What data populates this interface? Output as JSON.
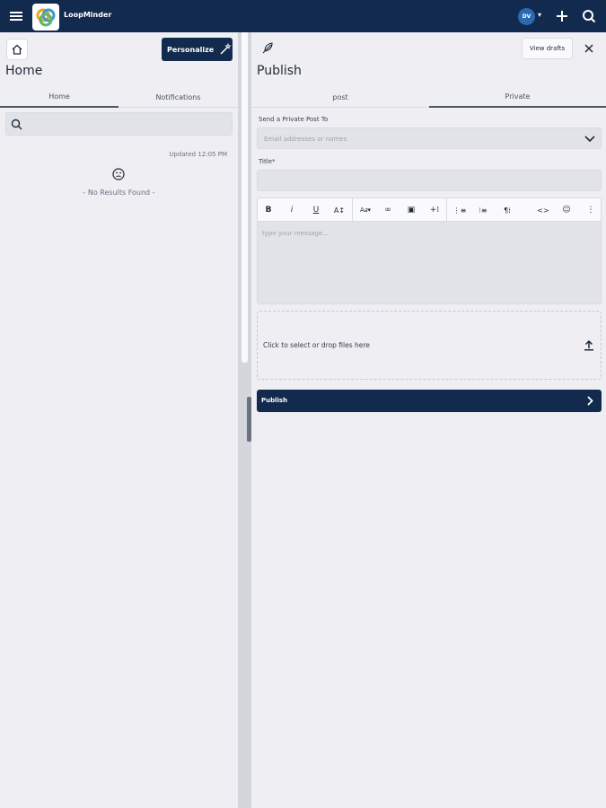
{
  "app": {
    "title": "LoopMinder",
    "avatar_initials": "DV",
    "caret": "▾",
    "colors": {
      "topbar": "#132a4f",
      "accent": "#2a6ab1",
      "panel": "#eeeef3"
    }
  },
  "left": {
    "title": "Home",
    "personalize_label": "Personalize",
    "tabs": [
      "Home",
      "Notifications"
    ],
    "active_tab": "Home",
    "updated": "Updated 12:05 PM",
    "empty_text": "- No Results Found -"
  },
  "right": {
    "title": "Publish",
    "view_drafts": "View drafts",
    "tabs": [
      "post",
      "Private"
    ],
    "active_tab": "Private",
    "send_label": "Send a Private Post To",
    "send_placeholder": "Email addresses or names",
    "title_label": "Title*",
    "editor_placeholder": "type your message...",
    "toolbar": {
      "bold": "B",
      "italic": "i",
      "underline": "U",
      "text_size": "A↕",
      "font": "A𝑎▾",
      "link": "∞",
      "image": "▣",
      "insert": "+⁞",
      "ordered_list": "⋮≡",
      "bullet_list": "⁝≡",
      "paragraph": "¶⁞",
      "code": "<>",
      "emoji": "☺",
      "more": "⋮"
    },
    "dropzone_text": "Click to select or drop files here",
    "publish_label": "Publish"
  }
}
